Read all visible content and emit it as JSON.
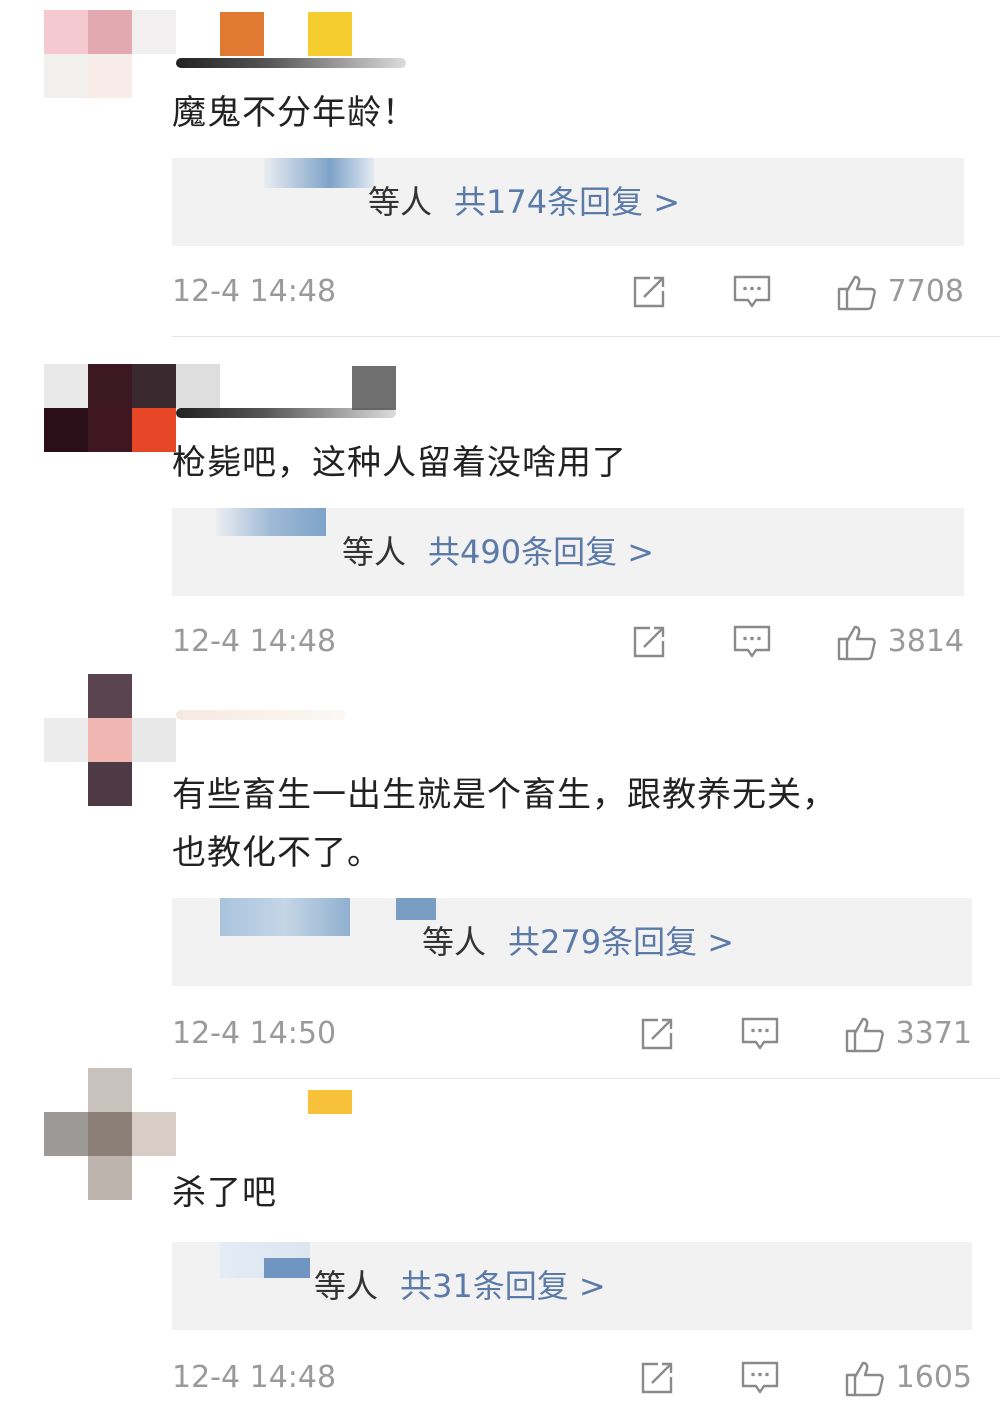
{
  "comments": [
    {
      "text": "魔鬼不分年龄！",
      "reply_suffix": "等人",
      "reply_count_label": "共174条回复 >",
      "time": "12-4 14:48",
      "likes": "7708"
    },
    {
      "text": "枪毙吧，这种人留着没啥用了",
      "reply_suffix": "等人",
      "reply_count_label": "共490条回复 >",
      "time": "12-4 14:48",
      "likes": "3814"
    },
    {
      "text": "有些畜生一出生就是个畜生，跟教养无关，\n也教化不了。",
      "reply_suffix": "等人",
      "reply_count_label": "共279条回复 >",
      "time": "12-4 14:50",
      "likes": "3371"
    },
    {
      "text": "杀了吧",
      "reply_suffix": "等人",
      "reply_count_label": "共31条回复 >",
      "time": "12-4 14:48",
      "likes": "1605"
    }
  ],
  "icons": {
    "share": "share-icon",
    "comment": "comment-icon",
    "like": "thumbs-up-icon"
  },
  "colors": {
    "link": "#5b7aa8",
    "meta_text": "#9a9a9a",
    "reply_bg": "#f2f2f2"
  }
}
